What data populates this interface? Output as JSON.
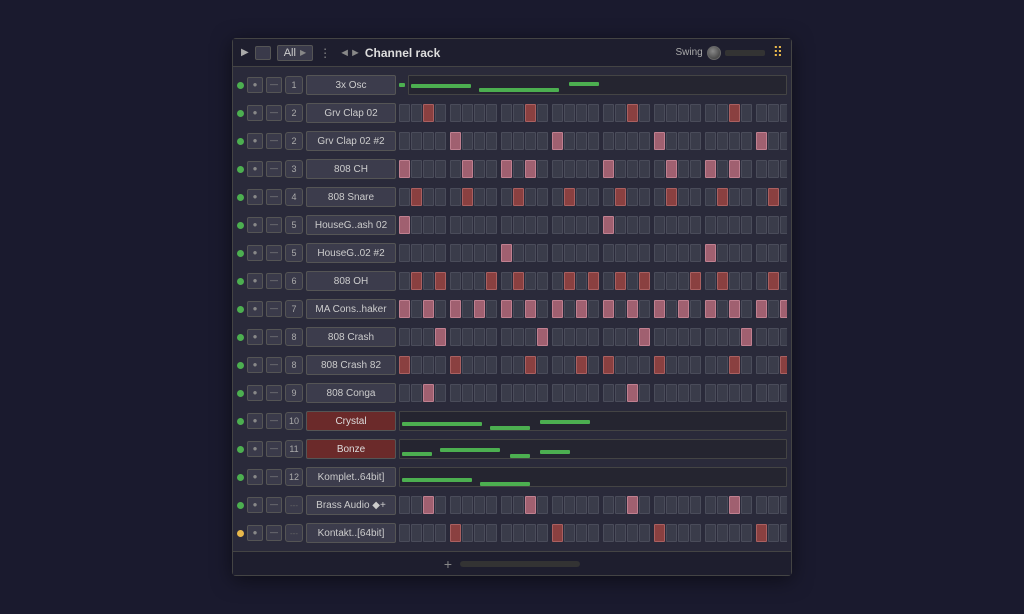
{
  "titleBar": {
    "allLabel": "All",
    "title": "Channel rack",
    "swingLabel": "Swing",
    "menuDots": "⋮",
    "playSymbol": "▶"
  },
  "channels": [
    {
      "num": "1",
      "name": "3x Osc",
      "type": "synth",
      "dotColor": "green",
      "hasGreenBar": true
    },
    {
      "num": "2",
      "name": "Grv Clap 02",
      "type": "beats",
      "dotColor": "green",
      "hasGreenBar": false
    },
    {
      "num": "2",
      "name": "Grv Clap 02 #2",
      "type": "beats",
      "dotColor": "green",
      "hasGreenBar": false
    },
    {
      "num": "3",
      "name": "808 CH",
      "type": "beats",
      "dotColor": "green",
      "hasGreenBar": false
    },
    {
      "num": "4",
      "name": "808 Snare",
      "type": "beats",
      "dotColor": "green",
      "hasGreenBar": false
    },
    {
      "num": "5",
      "name": "HouseG..ash 02",
      "type": "beats",
      "dotColor": "green",
      "hasGreenBar": false
    },
    {
      "num": "5",
      "name": "HouseG..02 #2",
      "type": "beats",
      "dotColor": "green",
      "hasGreenBar": false
    },
    {
      "num": "6",
      "name": "808 OH",
      "type": "beats",
      "dotColor": "green",
      "hasGreenBar": false
    },
    {
      "num": "7",
      "name": "MA Cons..haker",
      "type": "beats",
      "dotColor": "green",
      "hasGreenBar": false
    },
    {
      "num": "8",
      "name": "808 Crash",
      "type": "beats",
      "dotColor": "green",
      "hasGreenBar": false
    },
    {
      "num": "8",
      "name": "808 Crash 82",
      "type": "beats",
      "dotColor": "green",
      "hasGreenBar": false
    },
    {
      "num": "9",
      "name": "808 Conga",
      "type": "beats",
      "dotColor": "green",
      "hasGreenBar": false
    },
    {
      "num": "10",
      "name": "Crystal",
      "type": "synth",
      "dotColor": "green",
      "hasGreenBar": false,
      "redBg": true
    },
    {
      "num": "11",
      "name": "Bonze",
      "type": "synth",
      "dotColor": "green",
      "hasGreenBar": false,
      "redBg": true
    },
    {
      "num": "12",
      "name": "Komplet..64bit]",
      "type": "synth",
      "dotColor": "green",
      "hasGreenBar": false
    },
    {
      "num": "---",
      "name": "Brass Audio ◆+",
      "type": "beats",
      "dotColor": "green",
      "hasGreenBar": false,
      "dashes": true
    },
    {
      "num": "---",
      "name": "Kontakt..[64bit]",
      "type": "beats",
      "dotColor": "yellow",
      "hasGreenBar": false,
      "dashes": true
    }
  ],
  "footer": {
    "plusLabel": "+"
  }
}
